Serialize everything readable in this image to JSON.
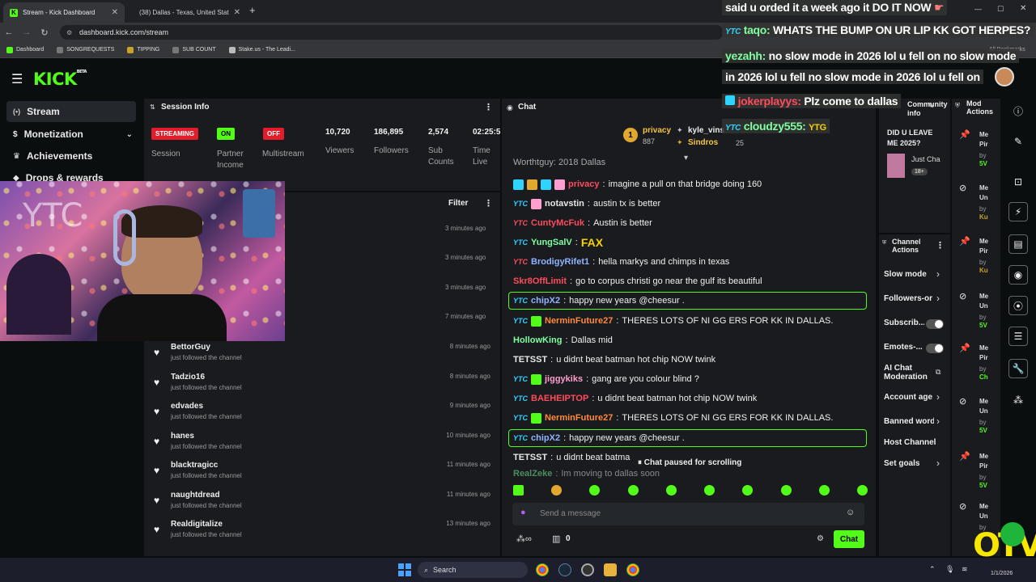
{
  "browser": {
    "tabs": [
      {
        "title": "Stream - Kick Dashboard"
      },
      {
        "title": "(38) Dallas - Texas, United Stat"
      }
    ],
    "url": "dashboard.kick.com/stream",
    "bookmarks": [
      "Dashboard",
      "SONGREQUESTS",
      "TIPPING",
      "SUB COUNT",
      "Stake.us - The Leadi..."
    ],
    "all_bookmarks": "All Bookmarks"
  },
  "app": {
    "logo": "KICK",
    "logo_beta": "BETA",
    "sidebar": [
      {
        "label": "Stream",
        "icon": "stream-icon"
      },
      {
        "label": "Monetization",
        "icon": "dollar-icon"
      },
      {
        "label": "Achievements",
        "icon": "trophy-icon"
      },
      {
        "label": "Drops & rewards",
        "icon": "gift-icon"
      }
    ]
  },
  "session": {
    "title": "Session Info",
    "badges": [
      {
        "text": "STREAMING",
        "label": "Session",
        "color": "#e11d2b"
      },
      {
        "text": "ON",
        "label": "Partner Income",
        "color": "#53fc18"
      },
      {
        "text": "OFF",
        "label": "Multistream",
        "color": "#e11d2b"
      }
    ],
    "stats": [
      {
        "value": "10,720",
        "label": "Viewers"
      },
      {
        "value": "186,895",
        "label": "Followers"
      },
      {
        "value": "2,574",
        "label": "Sub Counts"
      },
      {
        "value": "02:25:5",
        "label": "Time Live"
      }
    ]
  },
  "feed": {
    "filter": "Filter",
    "upper_times": [
      "3 minutes ago",
      "3 minutes ago",
      "3 minutes ago",
      "7 minutes ago"
    ],
    "items": [
      {
        "name": "BettorGuy",
        "action": "just followed the channel",
        "time": "8 minutes ago"
      },
      {
        "name": "Tadzio16",
        "action": "just followed the channel",
        "time": "8 minutes ago"
      },
      {
        "name": "edvades",
        "action": "just followed the channel",
        "time": "9 minutes ago"
      },
      {
        "name": "hanes",
        "action": "just followed the channel",
        "time": "10 minutes ago"
      },
      {
        "name": "blacktragicc",
        "action": "just followed the channel",
        "time": "11 minutes ago"
      },
      {
        "name": "naughtdread",
        "action": "just followed the channel",
        "time": "11 minutes ago"
      },
      {
        "name": "Realdigitalize",
        "action": "just followed the channel",
        "time": "13 minutes ago"
      }
    ]
  },
  "chat": {
    "title": "Chat",
    "leaderboard": [
      {
        "name": "privacy",
        "count": "887"
      },
      {
        "name": "kyle_vins",
        "count": ""
      },
      {
        "name": "Sindros",
        "count": "25"
      }
    ],
    "top_partial": "Worthtguy: 2018 Dallas",
    "messages": [
      {
        "user": "privacy",
        "color": "#ff4b5c",
        "text": "imagine a pull on that bridge doing 160",
        "badges": 4
      },
      {
        "user": "notavstin",
        "color": "#e8e8e8",
        "text": "austin tx is better",
        "badges": 2
      },
      {
        "user": "CuntyMcFuk",
        "color": "#ff4b5c",
        "text": "Austin is better",
        "badges": 1
      },
      {
        "user": "YungSalV",
        "color": "#7fffa0",
        "text": "FAX",
        "badges": 1
      },
      {
        "user": "BrodigyRifet1",
        "color": "#8fb4ff",
        "text": "hella markys and chimps in texas",
        "badges": 1
      },
      {
        "user": "Skr8OffLimit",
        "color": "#ff4b5c",
        "text": "go to corpus christi go near the gulf its beautiful",
        "badges": 0
      },
      {
        "user": "chipX2",
        "color": "#8fb4ff",
        "text": "happy new years @cheesur .",
        "badges": 1,
        "highlight": true
      },
      {
        "user": "NerminFuture27",
        "color": "#ff8a3d",
        "text": "THERES LOTS OF NI GG ERS FOR KK IN DALLAS.",
        "badges": 2
      },
      {
        "user": "HollowKing",
        "color": "#7fffa0",
        "text": "Dallas mid",
        "badges": 0
      },
      {
        "user": "TETSST",
        "color": "#e8e8e8",
        "text": "u didnt beat batman hot chip NOW twink",
        "badges": 0
      },
      {
        "user": "jiggykiks",
        "color": "#ff9fd0",
        "text": "gang are you colour blind ?",
        "badges": 2
      },
      {
        "user": "BAEHEIPTOP",
        "color": "#ff4b5c",
        "text": "u didnt beat batman hot chip NOW twink",
        "badges": 1
      },
      {
        "user": "NerminFuture27",
        "color": "#ff8a3d",
        "text": "THERES LOTS OF NI GG ERS FOR KK IN DALLAS.",
        "badges": 2
      },
      {
        "user": "chipX2",
        "color": "#8fb4ff",
        "text": "happy new years @cheesur .",
        "badges": 1,
        "highlight": true
      },
      {
        "user": "TETSST",
        "color": "#e8e8e8",
        "text": "u didnt beat batma",
        "badges": 0
      },
      {
        "user": "RealZeke",
        "color": "#7fffa0",
        "text": "Im moving to dallas soon",
        "badges": 0
      }
    ],
    "paused": "Chat paused for scrolling",
    "placeholder": "Send a message",
    "gift_count": "0",
    "send": "Chat"
  },
  "channel_actions": {
    "title": "Channel Actions",
    "community_title": "Community info",
    "community_question": "DID U LEAVE ME 2025?",
    "community_user": "Just Cha",
    "community_badge": "18+",
    "items": [
      {
        "label": "Slow mode",
        "kind": "chevron"
      },
      {
        "label": "Followers-or",
        "kind": "chevron"
      },
      {
        "label": "Subscrib...",
        "kind": "toggle"
      },
      {
        "label": "Emotes-...",
        "kind": "toggle"
      },
      {
        "label": "AI Chat Moderation",
        "kind": "link"
      },
      {
        "label": "Account age",
        "kind": "chevron"
      },
      {
        "label": "Banned word",
        "kind": "chevron"
      },
      {
        "label": "Host Channel",
        "kind": "none"
      },
      {
        "label": "Set goals",
        "kind": "chevron"
      }
    ]
  },
  "mod_actions": {
    "title": "Mod Actions",
    "entries": [
      {
        "a": "Me",
        "b": "Pir",
        "by": "by",
        "who": "5V"
      },
      {
        "a": "Me",
        "b": "Un",
        "by": "by",
        "who": "Ku"
      },
      {
        "a": "Me",
        "b": "Pir",
        "by": "by",
        "who": "Ku"
      },
      {
        "a": "Me",
        "b": "Un",
        "by": "by",
        "who": "5V"
      },
      {
        "a": "Me",
        "b": "Pir",
        "by": "by",
        "who": "Ch"
      },
      {
        "a": "Me",
        "b": "Un",
        "by": "by",
        "who": "5V"
      },
      {
        "a": "Me",
        "b": "Pir",
        "by": "by",
        "who": "5V"
      },
      {
        "a": "Me",
        "b": "Un",
        "by": "by",
        "who": ""
      }
    ]
  },
  "overlay": {
    "lines": [
      {
        "user": "",
        "text": "said u orded it a week ago it DO IT NOW"
      },
      {
        "user": "taqo:",
        "text": "WHATS THE BUMP ON UR LIP KK GOT HERPES?"
      },
      {
        "user": "yezahh:",
        "text": "no slow mode in 2026 lol u fell on no slow mode"
      },
      {
        "user": "",
        "text": "in 2026 lol u fell no slow mode in 2026 lol u fell on"
      },
      {
        "user": "jokerplayys:",
        "text": "Plz come to dallas"
      },
      {
        "user": "cloudzy555:",
        "text": "YTG"
      }
    ],
    "webcam_text": "YTC"
  },
  "taskbar": {
    "search": "Search",
    "date": "1/1/2026"
  },
  "colors": {
    "kick_green": "#53fc18",
    "panel": "#191b1f",
    "background": "#0b0e0f"
  }
}
